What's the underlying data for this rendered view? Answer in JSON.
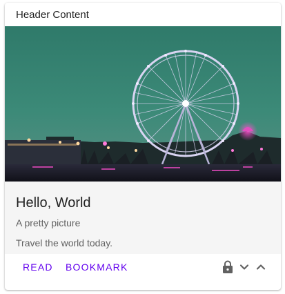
{
  "card": {
    "header": "Header Content",
    "title": "Hello, World",
    "subtitle": "A pretty picture",
    "text": "Travel the world today.",
    "actions": {
      "read_label": "READ",
      "bookmark_label": "BOOKMARK"
    },
    "icons": [
      "lock-icon",
      "chevron-down-icon",
      "chevron-up-icon"
    ],
    "colors": {
      "accent": "#6200ee",
      "body_bg": "#f5f5f5"
    }
  }
}
